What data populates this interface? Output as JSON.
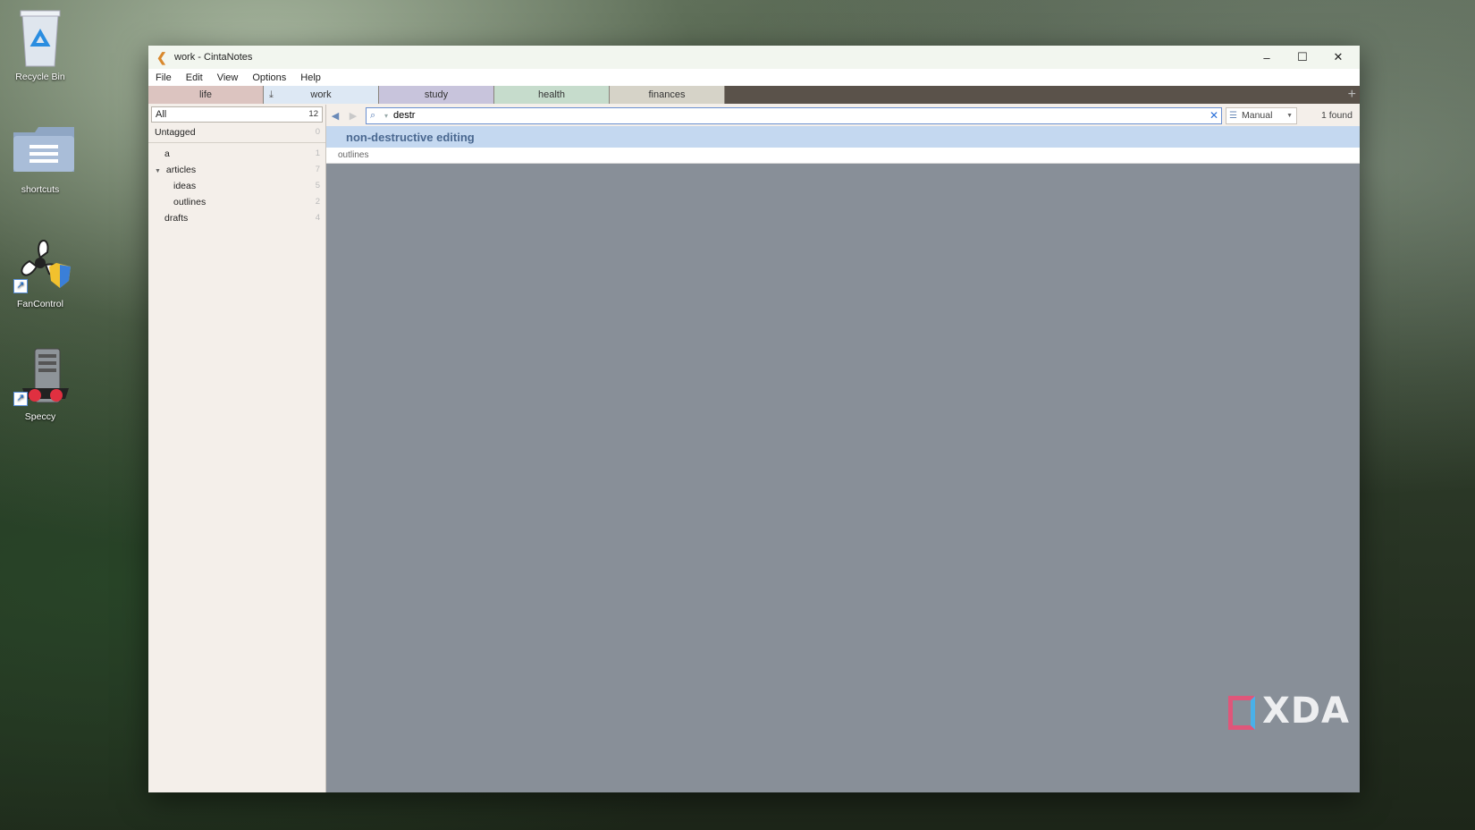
{
  "desktop": {
    "icons": [
      {
        "label": "Recycle Bin"
      },
      {
        "label": "shortcuts"
      },
      {
        "label": "FanControl"
      },
      {
        "label": "Speccy"
      }
    ]
  },
  "window": {
    "title": "work - CintaNotes",
    "controls": {
      "minimize": "–",
      "maximize": "☐",
      "close": "✕"
    }
  },
  "menu": [
    "File",
    "Edit",
    "View",
    "Options",
    "Help"
  ],
  "tabs": [
    "life",
    "work",
    "study",
    "health",
    "finances"
  ],
  "sidebar": {
    "all": {
      "label": "All",
      "count": "12"
    },
    "untagged": {
      "label": "Untagged",
      "count": "0"
    },
    "tags": [
      {
        "label": "a",
        "count": "1"
      },
      {
        "label": "articles",
        "count": "7"
      },
      {
        "label": "ideas",
        "count": "5"
      },
      {
        "label": "outlines",
        "count": "2"
      },
      {
        "label": "drafts",
        "count": "4"
      }
    ]
  },
  "search": {
    "value": "destr",
    "sort": "Manual",
    "found": "1 found"
  },
  "results": [
    {
      "title": "non-destructive editing",
      "tag": "outlines"
    }
  ],
  "watermark": "XDA",
  "colors": {
    "accent": "#c4d8f0",
    "list_bg": "#888f98",
    "sidebar_bg": "#f4efea"
  }
}
